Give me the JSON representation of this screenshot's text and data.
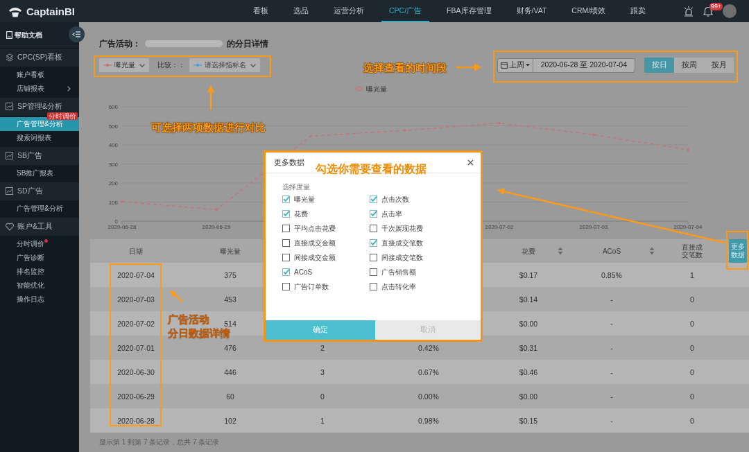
{
  "topbar": {
    "brand": "CaptainBI",
    "nav": [
      {
        "label": "看板",
        "selected": false
      },
      {
        "label": "选品",
        "selected": false
      },
      {
        "label": "运营分析",
        "selected": false
      },
      {
        "label": "CPC/广告",
        "selected": true
      },
      {
        "label": "FBA库存管理",
        "selected": false
      },
      {
        "label": "财务/VAT",
        "selected": false
      },
      {
        "label": "CRM/绩效",
        "selected": false
      },
      {
        "label": "跟卖",
        "selected": false
      }
    ],
    "notification_count": "99+"
  },
  "sidebar": {
    "help": "帮助文档",
    "groups": [
      {
        "title": "CPC(SP)看板",
        "kind": "layers",
        "items": [
          {
            "label": "账户看板",
            "selected": false,
            "dot": false,
            "submenu": false
          },
          {
            "label": "店铺报表",
            "selected": false,
            "dot": false,
            "submenu": true
          }
        ]
      },
      {
        "title": "SP管理&分析",
        "kind": "report",
        "items": [
          {
            "label": "广告管理&分析",
            "selected": true,
            "dot": false,
            "submenu": false,
            "badge": "分时调价"
          },
          {
            "label": "搜索词报表",
            "selected": false,
            "dot": false,
            "submenu": false
          }
        ]
      },
      {
        "title": "SB广告",
        "kind": "report",
        "items": [
          {
            "label": "SB推广报表",
            "selected": false,
            "dot": false,
            "submenu": false
          }
        ]
      },
      {
        "title": "SD广告",
        "kind": "report",
        "items": [
          {
            "label": "广告管理&分析",
            "selected": false,
            "dot": false,
            "submenu": false
          }
        ]
      },
      {
        "title": "账户&工具",
        "kind": "heart",
        "items": [
          {
            "label": "分时调价",
            "selected": false,
            "dot": true,
            "submenu": false
          },
          {
            "label": "广告诊断",
            "selected": false,
            "dot": false,
            "submenu": false
          },
          {
            "label": "排名监控",
            "selected": false,
            "dot": false,
            "submenu": false
          },
          {
            "label": "智能优化",
            "selected": false,
            "dot": false,
            "submenu": false
          },
          {
            "label": "操作日志",
            "selected": false,
            "dot": false,
            "submenu": false
          }
        ]
      }
    ]
  },
  "main": {
    "title_prefix": "广告活动：",
    "title_suffix": "的分日详情",
    "metric_select": {
      "value": "曝光量",
      "color": "#c8707c"
    },
    "compare_label": "比较：：",
    "compare_select": {
      "placeholder": "请选择指标名",
      "color": "#4f9fd4"
    },
    "date_range": {
      "preset": "上周",
      "value": "2020-06-28 至 2020-07-04"
    },
    "granularity": [
      {
        "label": "按日",
        "selected": true
      },
      {
        "label": "按周",
        "selected": false
      },
      {
        "label": "按月",
        "selected": false
      }
    ],
    "chart": {
      "chart_data": {
        "type": "line",
        "grid": true,
        "categories": [
          "2020-06-28",
          "2020-06-29",
          null,
          null,
          "2020-07-02",
          "2020-07-03",
          "2020-07-04"
        ],
        "series": [
          {
            "name": "曝光量",
            "color": "#c8707c",
            "line_style": "dashed",
            "values": [
              102,
              60,
              446,
              476,
              514,
              453,
              375
            ]
          }
        ],
        "ylim": [
          0,
          600
        ],
        "yticks": [
          0,
          100,
          200,
          300,
          400,
          500,
          600
        ]
      }
    },
    "table": {
      "columns": [
        {
          "label": "日期",
          "sortable": false
        },
        {
          "label": "曝光量",
          "sortable": false
        },
        null,
        null,
        {
          "label": "花费",
          "sortable": true
        },
        {
          "label": "ACoS",
          "sortable": true
        },
        {
          "label": "直接成交笔数",
          "sortable": false
        }
      ],
      "more_button": "更多数据",
      "rows": [
        [
          "2020-07-04",
          "375",
          null,
          null,
          "$0.17",
          "0.85%",
          "1"
        ],
        [
          "2020-07-03",
          "453",
          null,
          null,
          "$0.14",
          "-",
          "0"
        ],
        [
          "2020-07-02",
          "514",
          null,
          null,
          "$0.00",
          "-",
          "0"
        ],
        [
          "2020-07-01",
          "476",
          "2",
          "0.42%",
          "$0.31",
          "-",
          "0"
        ],
        [
          "2020-06-30",
          "446",
          "3",
          "0.67%",
          "$0.46",
          "-",
          "0"
        ],
        [
          "2020-06-29",
          "60",
          "0",
          "0.00%",
          "$0.00",
          "-",
          "0"
        ],
        [
          "2020-06-28",
          "102",
          "1",
          "0.98%",
          "$0.15",
          "-",
          "0"
        ]
      ],
      "footer": "显示第 1 到第 7 条记录，总共 7 条记录"
    }
  },
  "dialog": {
    "title": "更多数据",
    "section_label": "选择度量",
    "metrics": [
      {
        "label": "曝光量",
        "checked": true
      },
      {
        "label": "点击次数",
        "checked": true
      },
      {
        "label": "花费",
        "checked": true
      },
      {
        "label": "点击率",
        "checked": true
      },
      {
        "label": "平均点击花费",
        "checked": false
      },
      {
        "label": "千次展现花费",
        "checked": false
      },
      {
        "label": "直接成交金额",
        "checked": false
      },
      {
        "label": "直接成交笔数",
        "checked": true
      },
      {
        "label": "间接成交金额",
        "checked": false
      },
      {
        "label": "间接成交笔数",
        "checked": false
      },
      {
        "label": "ACoS",
        "checked": true
      },
      {
        "label": "广告销售额",
        "checked": false
      },
      {
        "label": "广告订单数",
        "checked": false
      },
      {
        "label": "点击转化率",
        "checked": false
      }
    ],
    "buttons": [
      {
        "label": "确定",
        "kind": "primary"
      },
      {
        "label": "取消",
        "kind": "secondary"
      }
    ]
  },
  "annotations": {
    "time_note": "选择查看的时间段",
    "compare_note": "可选择两项数据进行对比",
    "dialog_note": "勾选你需要查看的数据",
    "table_note": [
      "广告活动",
      "分日数据详情"
    ]
  }
}
